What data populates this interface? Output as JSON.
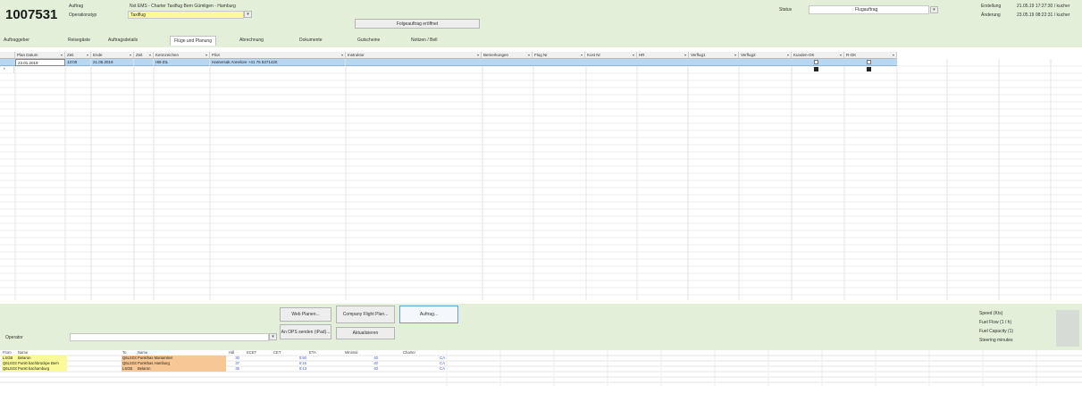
{
  "header": {
    "order_number": "1007531",
    "auftrag_label": "Auftrag",
    "auftrag_value": "Nxt EMS - Charter Taxiflug Bern Gümligen - Hamburg",
    "operation_label": "Operationstyp",
    "operation_value": "Taxiflug",
    "open_button": "Folgeauftrag eröffnet",
    "status_label": "Status",
    "status_value": "Flugauftrag",
    "created_label": "Erstellung",
    "created_value": "21.05.19 17:27:30 / kucher",
    "modified_label": "Änderung",
    "modified_value": "23.05.19 08:22:31 / kucher"
  },
  "tabs": [
    {
      "label": "Auftraggeber",
      "active": false
    },
    {
      "label": "Reisegäste",
      "active": false
    },
    {
      "label": "Auftragsdetails",
      "active": false
    },
    {
      "label": "Flüge und Planung",
      "active": true
    },
    {
      "label": "Abrechnung",
      "active": false
    },
    {
      "label": "Dokumente",
      "active": false
    },
    {
      "label": "Gutscheine",
      "active": false
    },
    {
      "label": "Notizen / Bell",
      "active": false
    }
  ],
  "grid": {
    "columns": [
      "Plan Datum",
      "Zeit",
      "Ende",
      "Zeit",
      "Kennzeichen",
      "Pilot",
      "Instruktor",
      "Bemerkungen",
      "Flug Nr",
      "Kost Nr",
      "HR",
      "Verflug1",
      "Verflug2",
      "Kunden-OK",
      "R-OK"
    ],
    "rows": [
      {
        "date": "23.01.2019",
        "time": "13:00",
        "end": "21.05.2019",
        "time2": "",
        "reg": "HB-ZIL",
        "pilot": "Hamersak Annelore   +41 76 5371420",
        "kunden_ok": false,
        "r_ok": false
      }
    ],
    "new_row_marker": "*"
  },
  "bottom": {
    "buttons": {
      "web_planen": "Web Planen...",
      "company_flight_plan": "Company Flight Plan...",
      "auftrag": "Auftrag...",
      "an_ops_senden": "An OPS senden (iPad)...",
      "aktualisieren": "Aktualisieren"
    },
    "operator_label": "Operator",
    "operator_value": "",
    "info": [
      "Speed (Kts)",
      "Fuel Flow (1 / h)",
      "Fuel Capacity (1)",
      "Steering minutes"
    ]
  },
  "routes": {
    "columns": [
      "From",
      "Name",
      "To",
      "Name",
      "Hdl",
      "ECET",
      "CET",
      "ETA",
      "Minimal",
      "Charter"
    ],
    "rows": [
      {
        "from": "LSGB",
        "from_name": "Belaron",
        "to": "Q6LSGG",
        "to_name": "Punkthas Mariamiten",
        "hdl": "30",
        "ecet": "",
        "cet": "0:50",
        "eta": "",
        "min": "40",
        "charter": "CA"
      },
      {
        "from": "Q6LSGG",
        "from_name": "Punkt bachbrückpe Bern",
        "to": "Q6LSGG",
        "to_name": "Punkthas Hamburg",
        "hdl": "37",
        "ecet": "",
        "cet": "0:15",
        "eta": "",
        "min": "40",
        "charter": "CA"
      },
      {
        "from": "Q6LSGG",
        "from_name": "Punkt bachamburg",
        "to": "LSGB",
        "to_name": "Belaron",
        "hdl": "35",
        "ecet": "",
        "cet": "0:13",
        "eta": "",
        "min": "40",
        "charter": "CA"
      }
    ]
  },
  "colors": {
    "panel": "#e3efd9",
    "selected_row": "#b8d7f2",
    "yellow": "#fbfa9a",
    "orange": "#f7c896",
    "blue_text": "#3a58e0"
  }
}
